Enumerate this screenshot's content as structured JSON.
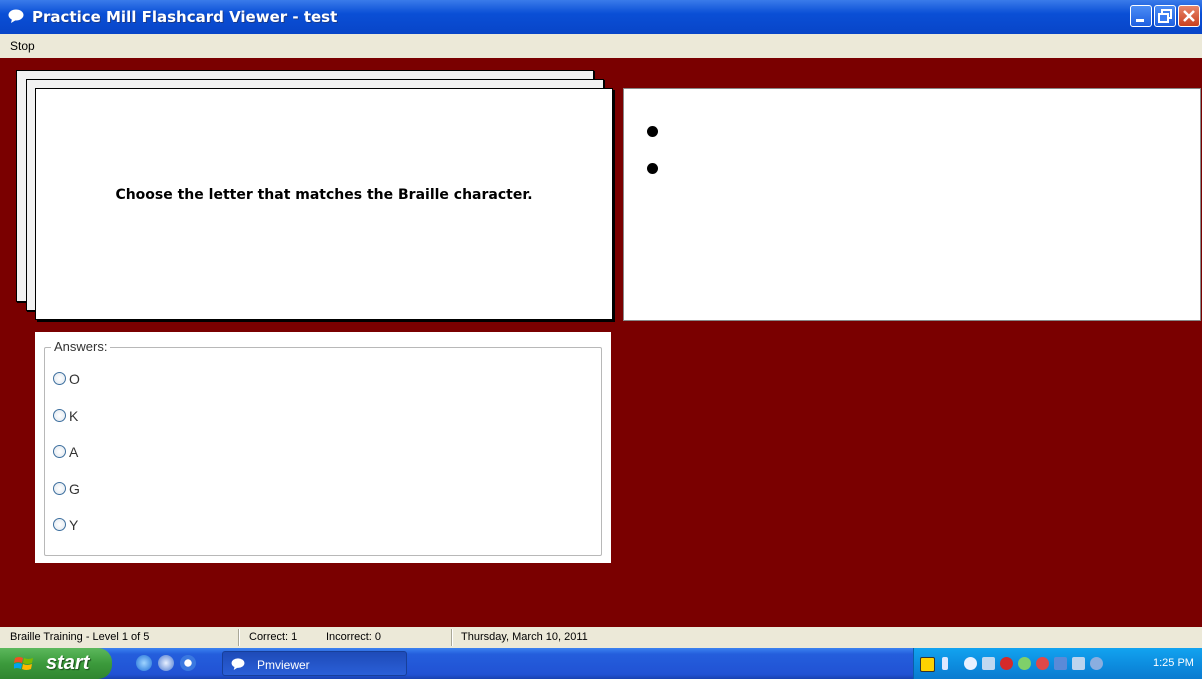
{
  "window": {
    "title": "Practice Mill Flashcard Viewer - test",
    "icon": "speech-bubble-icon"
  },
  "menu": {
    "stop_label": "Stop"
  },
  "card": {
    "question": "Choose the letter that matches the Braille character."
  },
  "braille": {
    "dots_shown": 2
  },
  "answers": {
    "legend": "Answers:",
    "options": [
      "O",
      "K",
      "A",
      "G",
      "Y"
    ],
    "selected": null
  },
  "status": {
    "training": "Braille Training  - Level 1 of 5",
    "correct": "Correct: 1",
    "incorrect": "Incorrect: 0",
    "date": "Thursday, March 10, 2011"
  },
  "taskbar": {
    "start_label": "start",
    "task_label": "Pmviewer",
    "clock": "1:25 PM"
  },
  "colors": {
    "background": "#7a0000",
    "titlebar": "#0a4fd6"
  }
}
